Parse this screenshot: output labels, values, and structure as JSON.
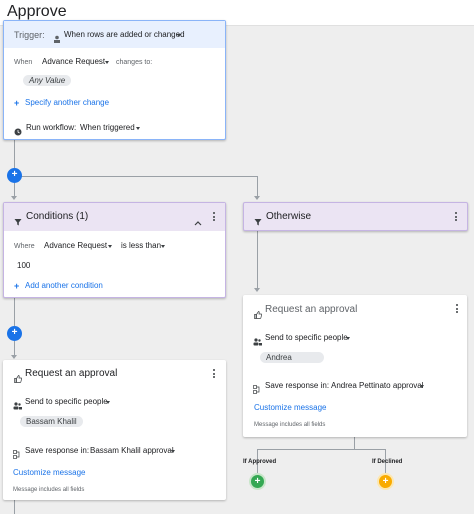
{
  "header": {
    "title": "Approve"
  },
  "trigger_card": {
    "trigger_label": "Trigger:",
    "trigger_value": "When rows are added or changed",
    "when_label": "When",
    "column_value": "Advance Request",
    "changes_to_label": "changes to:",
    "any_value_chip": "Any Value",
    "specify_link": "Specify another change",
    "run_label": "Run workflow:",
    "run_value": "When triggered"
  },
  "conditions_card": {
    "title": "Conditions (1)",
    "where_label": "Where",
    "column_value": "Advance Request",
    "operator_value": "is less than",
    "value": "100",
    "add_link": "Add another condition"
  },
  "otherwise_card": {
    "title": "Otherwise"
  },
  "approval_left": {
    "title": "Request an approval",
    "send_label": "Send to specific people",
    "person_chip": "Bassam Khalil",
    "save_label": "Save response in:",
    "save_value": "Bassam Khalil approval",
    "customize_link": "Customize message",
    "message_note": "Message includes all fields"
  },
  "approval_right": {
    "title": "Request an approval",
    "send_label": "Send to specific people",
    "person_chip": "Andrea",
    "save_label": "Save response in:",
    "save_value": "Andrea Pettinato approval",
    "customize_link": "Customize message",
    "message_note": "Message includes all fields"
  },
  "branches": {
    "approved_label": "If Approved",
    "declined_label": "If Declined"
  },
  "colors": {
    "add_blue": "#1a73e8",
    "approved_green": "#34a853",
    "declined_orange": "#f9ab00",
    "condition_purple": "#ebe4f3"
  },
  "icons": {
    "add": "plus-icon",
    "filter": "filter-icon",
    "thumb": "thumb-up-icon",
    "people": "people-icon",
    "save": "save-response-icon",
    "clock": "clock-icon",
    "menu": "more-vert-icon",
    "collapse": "chevron-up-icon"
  }
}
